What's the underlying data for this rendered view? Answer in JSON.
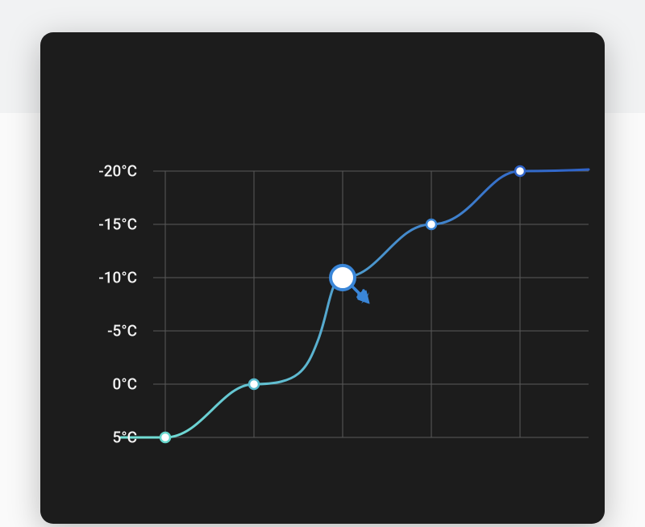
{
  "chart_data": {
    "type": "line",
    "xlabel": "",
    "ylabel": "",
    "title": "",
    "y_tick_labels": [
      "-20°C",
      "-15°C",
      "-10°C",
      "-5°C",
      "0°C",
      "5°C"
    ],
    "y_tick_values": [
      -20,
      -15,
      -10,
      -5,
      0,
      5
    ],
    "ylim": [
      5,
      -20
    ],
    "x": [
      0,
      1,
      2,
      3,
      4,
      5
    ],
    "values": [
      5,
      0,
      -10,
      -15,
      -20,
      -20
    ],
    "highlighted_index": 2,
    "gradient_colors": [
      "#73e0d4",
      "#2f63c9"
    ],
    "grid": true
  }
}
